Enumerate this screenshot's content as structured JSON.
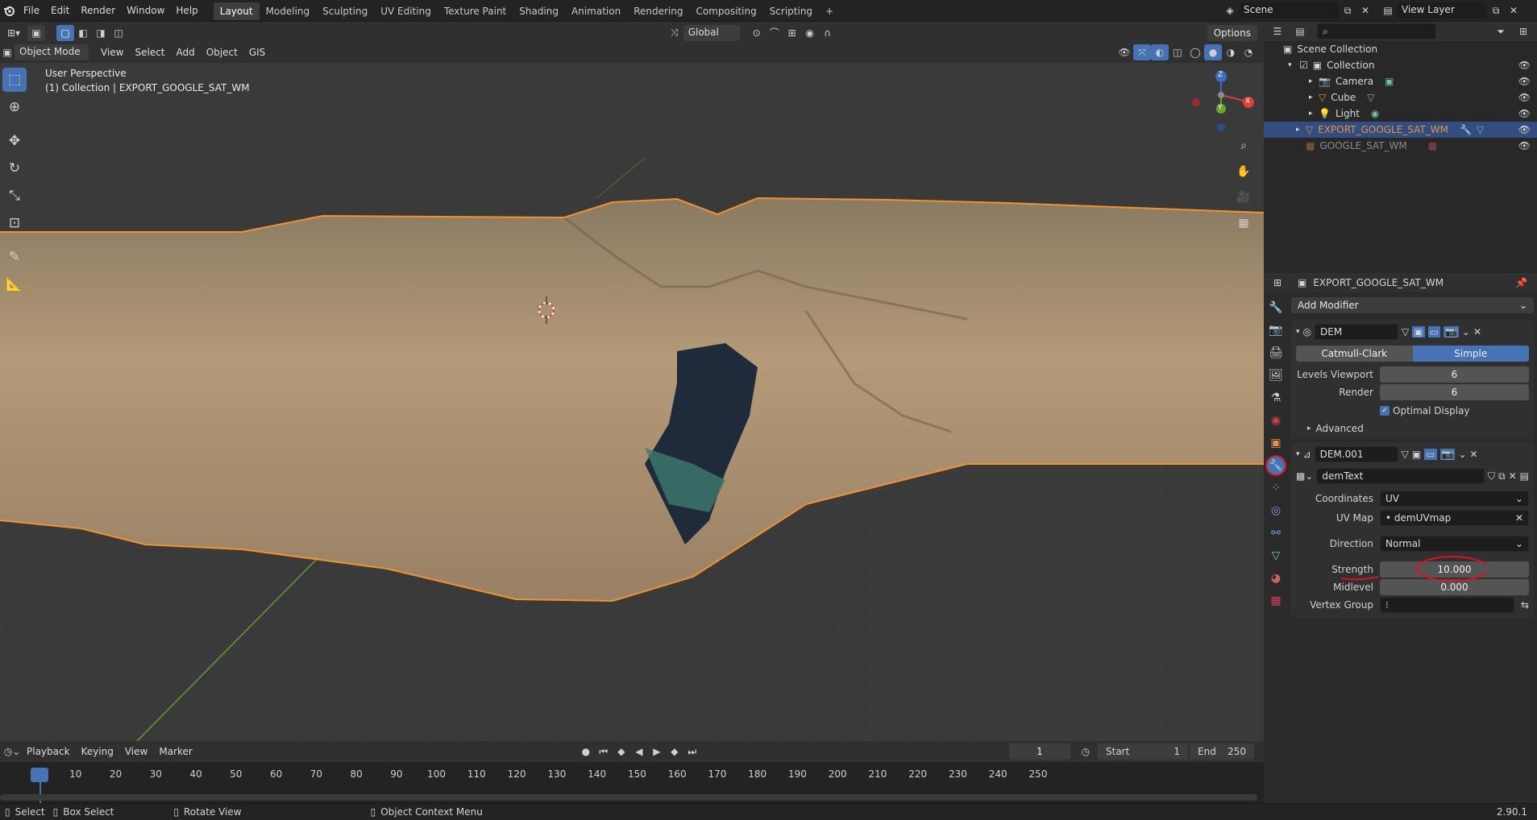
{
  "topbar": {
    "menus": [
      "File",
      "Edit",
      "Render",
      "Window",
      "Help"
    ],
    "workspaces": [
      "Layout",
      "Modeling",
      "Sculpting",
      "UV Editing",
      "Texture Paint",
      "Shading",
      "Animation",
      "Rendering",
      "Compositing",
      "Scripting"
    ],
    "active_workspace": "Layout",
    "add_tab": "+",
    "scene": "Scene",
    "view_layer": "View Layer"
  },
  "toolbar2": {
    "orientation": "Global",
    "options": "Options"
  },
  "viewport": {
    "mode": "Object Mode",
    "menus": [
      "View",
      "Select",
      "Add",
      "Object",
      "GIS"
    ],
    "overlay_line1": "User Perspective",
    "overlay_line2": "(1) Collection | EXPORT_GOOGLE_SAT_WM",
    "axes": {
      "x": "X",
      "y": "Y",
      "z": "Z"
    }
  },
  "outliner": {
    "root": "Scene Collection",
    "items": [
      {
        "label": "Collection",
        "color": "#d8d8d8"
      },
      {
        "label": "Camera",
        "color": "#d8d8d8"
      },
      {
        "label": "Cube",
        "color": "#d8d8d8"
      },
      {
        "label": "Light",
        "color": "#d8d8d8"
      },
      {
        "label": "EXPORT_GOOGLE_SAT_WM",
        "color": "#e0914c"
      },
      {
        "label": "GOOGLE_SAT_WM",
        "color": "#8a8a8a"
      }
    ]
  },
  "properties": {
    "object_name": "EXPORT_GOOGLE_SAT_WM",
    "add_modifier": "Add Modifier",
    "mod1": {
      "name": "DEM",
      "type_a": "Catmull-Clark",
      "type_b": "Simple",
      "levels_viewport_label": "Levels Viewport",
      "levels_viewport": "6",
      "render_label": "Render",
      "render": "6",
      "optimal_display": "Optimal Display",
      "advanced": "Advanced"
    },
    "mod2": {
      "name": "DEM.001",
      "texture": "demText",
      "coordinates_label": "Coordinates",
      "coordinates": "UV",
      "uvmap_label": "UV Map",
      "uvmap": "demUVmap",
      "direction_label": "Direction",
      "direction": "Normal",
      "strength_label": "Strength",
      "strength": "10.000",
      "midlevel_label": "Midlevel",
      "midlevel": "0.000",
      "vertex_group_label": "Vertex Group"
    }
  },
  "timeline": {
    "menus": [
      "Playback",
      "Keying",
      "View",
      "Marker"
    ],
    "current_frame": "1",
    "start_label": "Start",
    "start": "1",
    "end_label": "End",
    "end": "250",
    "ticks": [
      "1",
      "10",
      "20",
      "30",
      "40",
      "50",
      "60",
      "70",
      "80",
      "90",
      "100",
      "110",
      "120",
      "130",
      "140",
      "150",
      "160",
      "170",
      "180",
      "190",
      "200",
      "210",
      "220",
      "230",
      "240",
      "250"
    ]
  },
  "statusbar": {
    "select": "Select",
    "box_select": "Box Select",
    "rotate_view": "Rotate View",
    "context_menu": "Object Context Menu",
    "version": "2.90.1"
  },
  "colors": {
    "accent": "#4772b3",
    "selection_outline": "#f0922d",
    "annotation": "#e0101a"
  }
}
